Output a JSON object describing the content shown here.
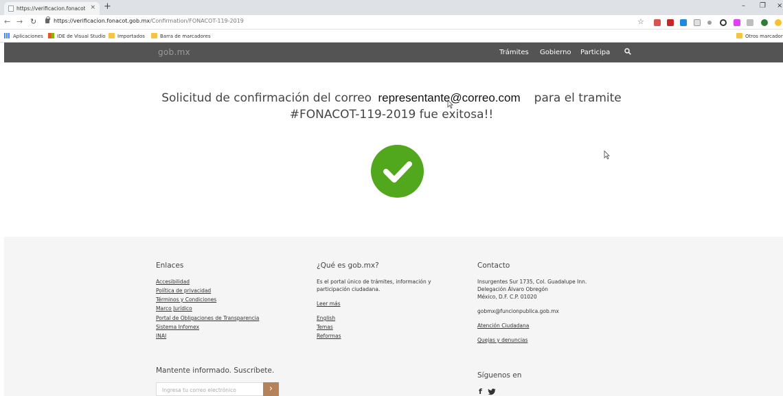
{
  "browser": {
    "tab_title": "https://verificacion.fonacot.gob.m",
    "new_tab": "+",
    "close_tab": "×",
    "url_host": "https://verificacion.fonacot.gob.mx",
    "url_path": "/Confirmation/FONACOT-119-2019",
    "bookmarks": [
      "Aplicaciones",
      "IDE de Visual Studio",
      "Importados",
      "Barra de marcadores"
    ],
    "other_bookmarks": "Otros marcadores"
  },
  "header": {
    "logo": "gob.mx",
    "nav": [
      "Trámites",
      "Gobierno",
      "Participa"
    ]
  },
  "main": {
    "line1_prefix": "Solicitud de confirmación del correo",
    "email": "representante@correo.com",
    "line1_suffix": "para el tramite",
    "line2": "#FONACOT-119-2019 fue exitosa!!"
  },
  "footer": {
    "enlaces": {
      "title": "Enlaces",
      "links": [
        "Accesibilidad",
        "Política de privacidad",
        "Términos y Condiciones",
        "Marco Jurídico",
        "Portal de Obligaciones de Transparencia",
        "Sistema Infomex",
        "INAI"
      ]
    },
    "que_es": {
      "title": "¿Qué es gob.mx?",
      "text_1": "Es el portal único de trámites, información y",
      "text_2": "participación ciudadana.",
      "leer_mas": "Leer más",
      "links": [
        "English",
        "Temas",
        "Reformas"
      ]
    },
    "contacto": {
      "title": "Contacto",
      "address_1": "Insurgentes Sur 1735, Col. Guadalupe Inn.",
      "address_2": "Delegación Álvaro Obregón",
      "address_3": "México, D.F. C.P. 01020",
      "email": "gobmx@funcionpublica.gob.mx",
      "links": [
        "Atención Ciudadana",
        "Quejas y denuncias"
      ]
    },
    "subscribe": {
      "title": "Mantente informado. Suscríbete.",
      "placeholder": "Ingresa tu correo electrónico",
      "button": "›"
    },
    "social": {
      "title": "Síguenos en",
      "icons": [
        "f",
        "t"
      ]
    }
  },
  "colors": {
    "header_bg": "#545454",
    "success_green": "#51a81c",
    "footer_bg": "#f5f5f5",
    "subscribe_button": "#b5835a"
  }
}
